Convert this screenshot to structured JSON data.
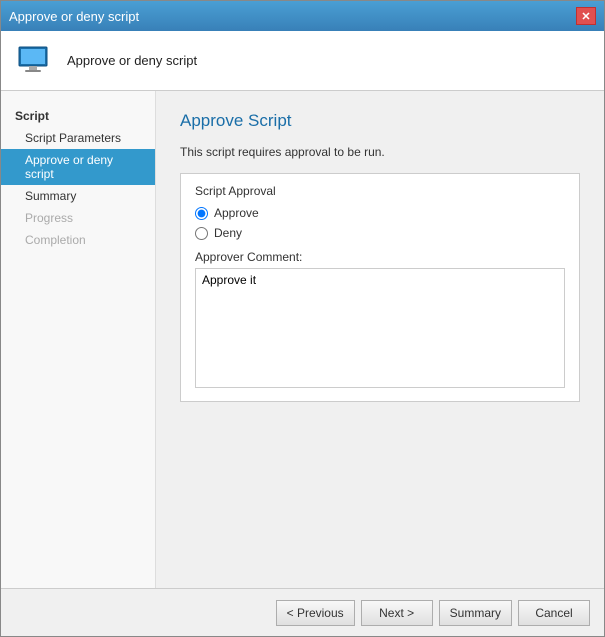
{
  "window": {
    "title": "Approve or deny script",
    "close_label": "✕"
  },
  "header": {
    "icon_alt": "computer-icon",
    "title": "Approve or deny script"
  },
  "sidebar": {
    "section_label": "Script",
    "items": [
      {
        "id": "script-parameters",
        "label": "Script Parameters",
        "state": "normal"
      },
      {
        "id": "approve-or-deny",
        "label": "Approve or deny script",
        "state": "active"
      },
      {
        "id": "summary",
        "label": "Summary",
        "state": "normal"
      },
      {
        "id": "progress",
        "label": "Progress",
        "state": "disabled"
      },
      {
        "id": "completion",
        "label": "Completion",
        "state": "disabled"
      }
    ]
  },
  "main": {
    "title": "Approve Script",
    "description": "This script requires approval to be run.",
    "approval_group_label": "Script Approval",
    "approve_label": "Approve",
    "deny_label": "Deny",
    "comment_label": "Approver Comment:",
    "comment_value": "Approve it"
  },
  "footer": {
    "previous_label": "< Previous",
    "next_label": "Next >",
    "summary_label": "Summary",
    "cancel_label": "Cancel"
  }
}
